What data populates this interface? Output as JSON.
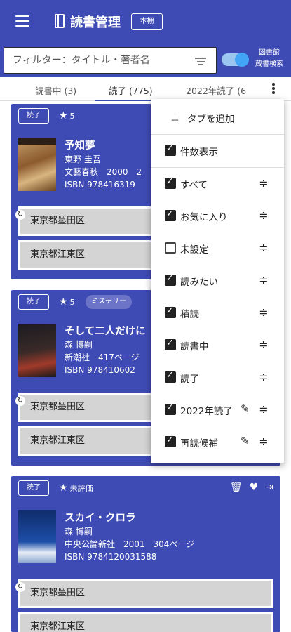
{
  "app": {
    "title": "読書管理",
    "shelf_button": "本棚",
    "menu_icon": "hamburger-icon",
    "book_icon": "book-icon"
  },
  "filter": {
    "placeholder": "フィルター：タイトル・著者名",
    "toggle_label": "図書館\n蔵書検索",
    "toggle_on": true
  },
  "tabs": [
    {
      "label": "読書中 (3)",
      "active": false
    },
    {
      "label": "読了 (775)",
      "active": true
    },
    {
      "label": "2022年読了 (6",
      "active": false
    }
  ],
  "colors": {
    "primary": "#3f4bb4",
    "accent": "#42a5f5",
    "library_bg": "#d4d4d4"
  },
  "books": [
    {
      "status": "読了",
      "rating": "5",
      "genre": "",
      "title": "予知夢",
      "author": "東野 圭吾",
      "publisher_line": "文藝春秋　2000　2",
      "isbn": "ISBN 978416319",
      "libraries": [
        "東京都墨田区",
        "東京都江東区"
      ]
    },
    {
      "status": "読了",
      "rating": "5",
      "genre": "ミステリー",
      "title": "そして二人だけに",
      "author": "森 博嗣",
      "publisher_line": "新潮社　417ページ",
      "isbn": "ISBN 978410602",
      "libraries": [
        "東京都墨田区",
        "東京都江東区"
      ]
    },
    {
      "status": "読了",
      "rating": "未評価",
      "genre": "",
      "title": "スカイ・クロラ",
      "author": "森 博嗣",
      "publisher_line": "中央公論新社　2001　304ページ",
      "isbn": "ISBN 9784120031588",
      "libraries": [
        "東京都墨田区",
        "東京都江東区"
      ]
    }
  ],
  "menu": {
    "add_tab": "タブを追加",
    "show_count": "件数表示",
    "items": [
      {
        "label": "すべて",
        "checked": true,
        "editable": false
      },
      {
        "label": "お気に入り",
        "checked": true,
        "editable": false
      },
      {
        "label": "未設定",
        "checked": false,
        "editable": false
      },
      {
        "label": "読みたい",
        "checked": true,
        "editable": false
      },
      {
        "label": "積読",
        "checked": true,
        "editable": false
      },
      {
        "label": "読書中",
        "checked": true,
        "editable": false
      },
      {
        "label": "読了",
        "checked": true,
        "editable": false
      },
      {
        "label": "2022年読了",
        "checked": true,
        "editable": true
      },
      {
        "label": "再読候補",
        "checked": true,
        "editable": true
      }
    ]
  }
}
